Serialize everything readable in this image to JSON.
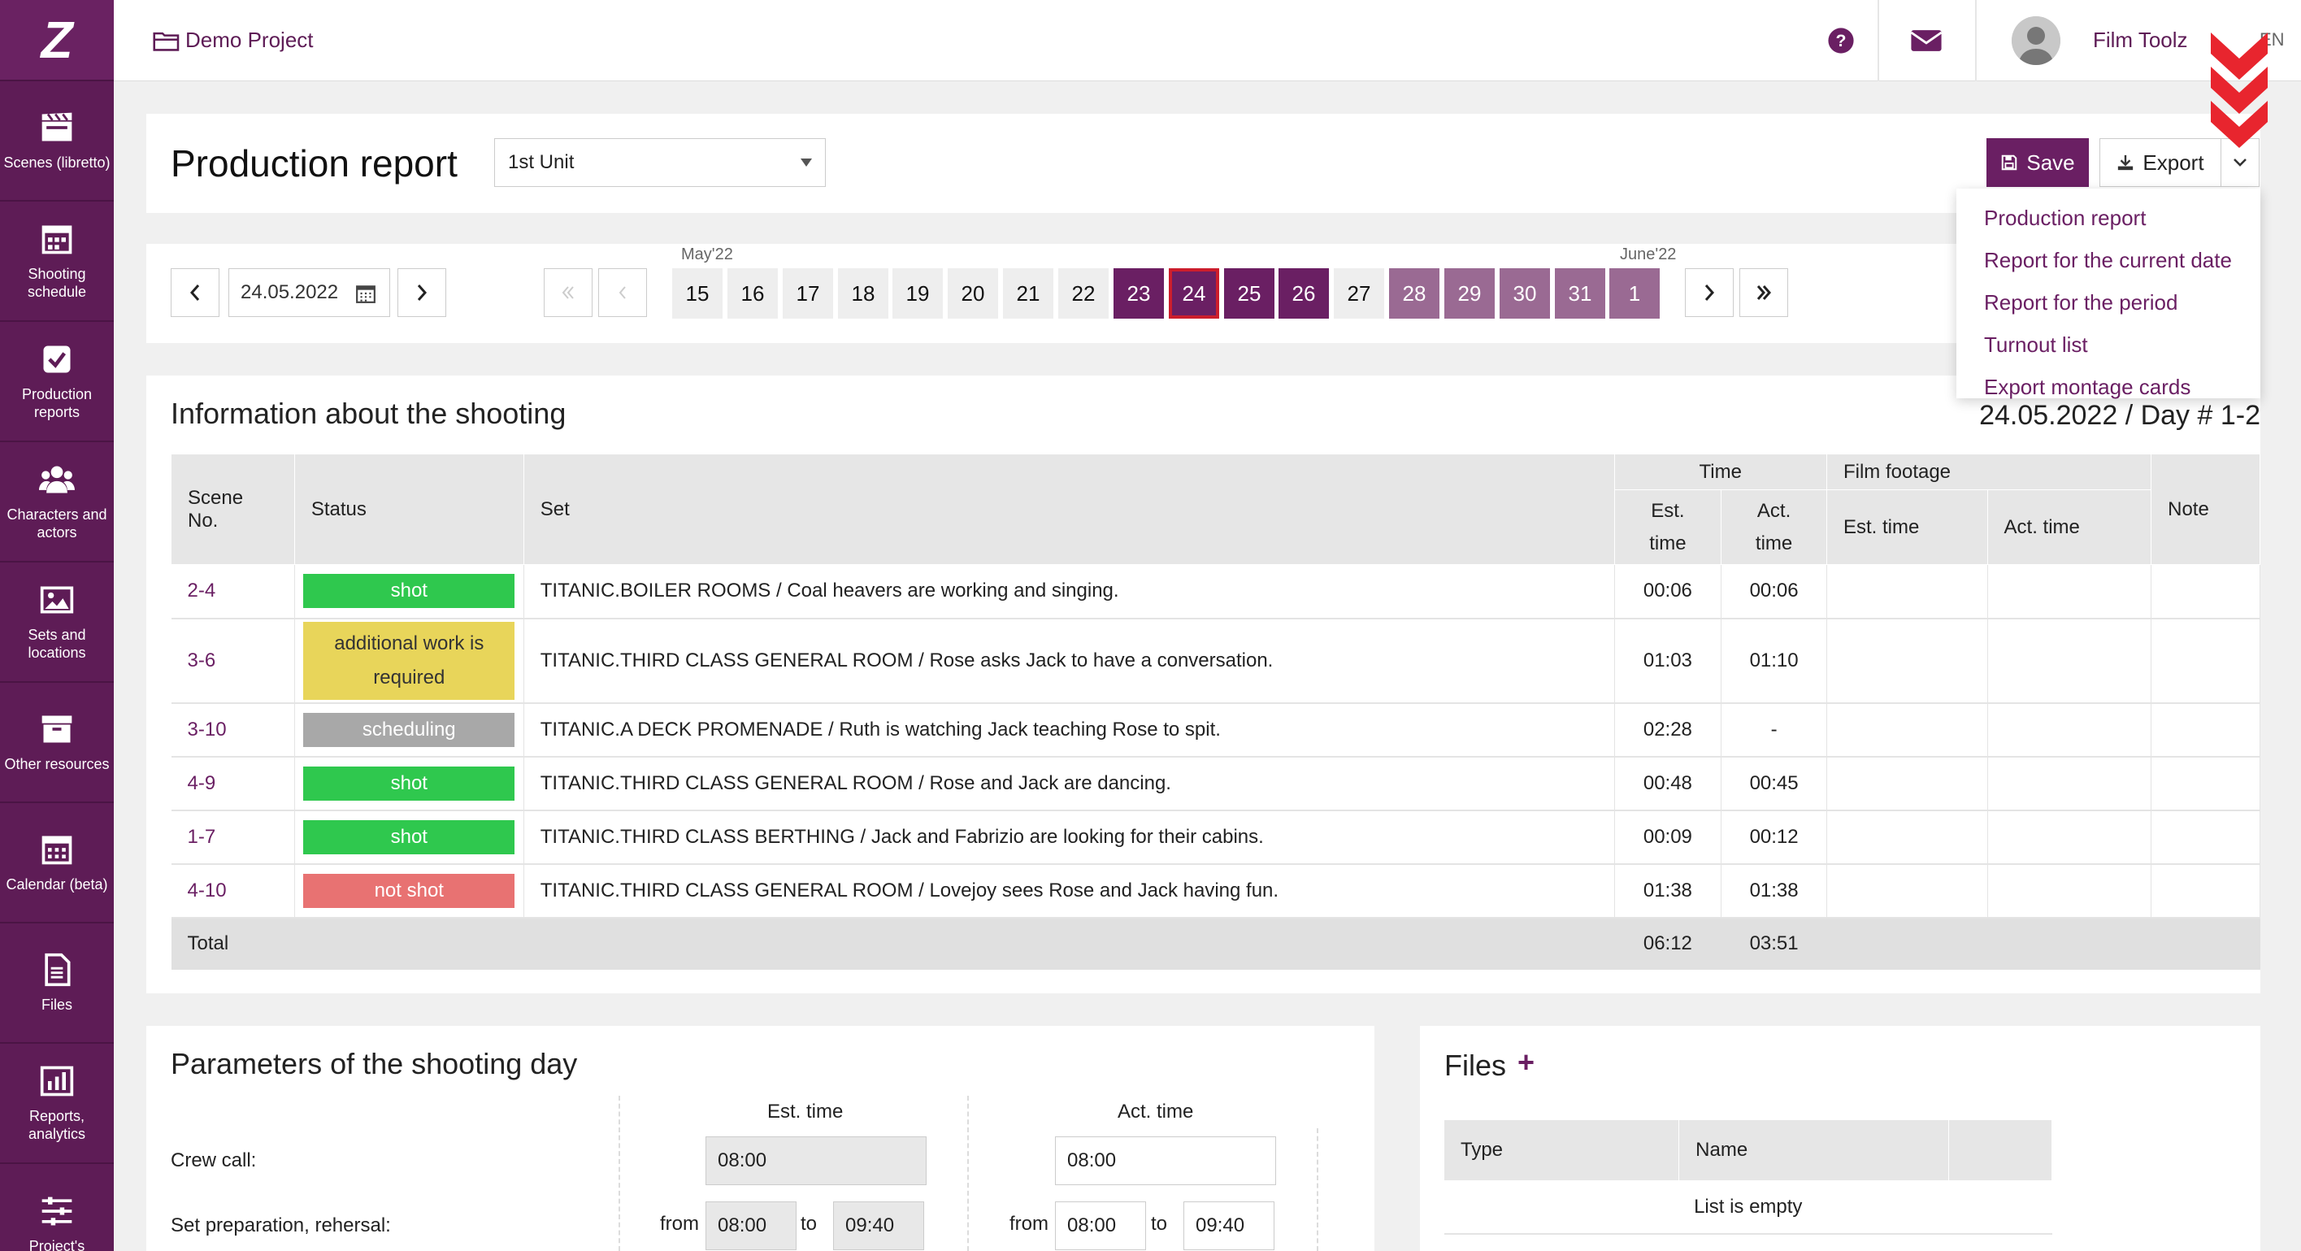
{
  "sidebar": {
    "logo": "Z",
    "items": [
      {
        "label": "Scenes (libretto)",
        "icon": "clapperboard-icon"
      },
      {
        "label": "Shooting schedule",
        "icon": "calendar-grid-icon"
      },
      {
        "label": "Production reports",
        "icon": "checkbox-icon"
      },
      {
        "label": "Characters and actors",
        "icon": "people-icon"
      },
      {
        "label": "Sets and locations",
        "icon": "image-icon"
      },
      {
        "label": "Other resources",
        "icon": "archive-box-icon"
      },
      {
        "label": "Calendar (beta)",
        "icon": "calendar-icon"
      },
      {
        "label": "Files",
        "icon": "file-icon"
      },
      {
        "label": "Reports, analytics",
        "icon": "bar-chart-icon"
      },
      {
        "label": "Project's",
        "icon": "sliders-icon"
      }
    ]
  },
  "topbar": {
    "project": "Demo Project",
    "user_name": "Film Toolz",
    "lang": "EN"
  },
  "header": {
    "title": "Production report",
    "unit_select": "1st Unit",
    "save_label": "Save",
    "export_label": "Export"
  },
  "export_menu": [
    "Production report",
    "Report for the current date",
    "Report for the period",
    "Turnout list",
    "Export montage cards"
  ],
  "date_nav": {
    "date": "24.05.2022",
    "month1": "May'22",
    "month2": "June'22",
    "days": [
      {
        "d": "15",
        "s": "empty"
      },
      {
        "d": "16",
        "s": "empty"
      },
      {
        "d": "17",
        "s": "empty"
      },
      {
        "d": "18",
        "s": "empty"
      },
      {
        "d": "19",
        "s": "empty"
      },
      {
        "d": "20",
        "s": "empty"
      },
      {
        "d": "21",
        "s": "empty"
      },
      {
        "d": "22",
        "s": "empty"
      },
      {
        "d": "23",
        "s": "dark"
      },
      {
        "d": "24",
        "s": "selected"
      },
      {
        "d": "25",
        "s": "dark"
      },
      {
        "d": "26",
        "s": "dark"
      },
      {
        "d": "27",
        "s": "empty"
      },
      {
        "d": "28",
        "s": "light"
      },
      {
        "d": "29",
        "s": "light"
      },
      {
        "d": "30",
        "s": "light"
      },
      {
        "d": "31",
        "s": "light"
      },
      {
        "d": "1",
        "s": "light"
      }
    ]
  },
  "info": {
    "title": "Information about the shooting",
    "day_label": "24.05.2022 / Day # 1-2",
    "headers": {
      "scene": "Scene No.",
      "status": "Status",
      "set": "Set",
      "time": "Time",
      "film": "Film footage",
      "est": "Est.",
      "act": "Act.",
      "time_word": "time",
      "est_time": "Est. time",
      "act_time": "Act. time",
      "note": "Note"
    },
    "rows": [
      {
        "scene": "2-4",
        "status": "shot",
        "status_color": "#2fc84e",
        "set": "TITANIC.BOILER ROOMS / Coal heavers are working and singing.",
        "est": "00:06",
        "act": "00:06"
      },
      {
        "scene": "3-6",
        "status": "additional work is required",
        "status_color": "#e8d55a",
        "set": "TITANIC.THIRD CLASS GENERAL ROOM / Rose asks Jack to have a conversation.",
        "est": "01:03",
        "act": "01:10"
      },
      {
        "scene": "3-10",
        "status": "scheduling",
        "status_color": "#a8a8a8",
        "set": "TITANIC.A DECK PROMENADE / Ruth is watching Jack teaching Rose to spit.",
        "est": "02:28",
        "act": "-"
      },
      {
        "scene": "4-9",
        "status": "shot",
        "status_color": "#2fc84e",
        "set": "TITANIC.THIRD CLASS GENERAL ROOM / Rose and Jack are dancing.",
        "est": "00:48",
        "act": "00:45"
      },
      {
        "scene": "1-7",
        "status": "shot",
        "status_color": "#2fc84e",
        "set": "TITANIC.THIRD CLASS BERTHING / Jack and Fabrizio are looking for their cabins.",
        "est": "00:09",
        "act": "00:12"
      },
      {
        "scene": "4-10",
        "status": "not shot",
        "status_color": "#e87272",
        "set": "TITANIC.THIRD CLASS GENERAL ROOM / Lovejoy sees Rose and Jack having fun.",
        "est": "01:38",
        "act": "01:38"
      }
    ],
    "total_label": "Total",
    "total_est": "06:12",
    "total_act": "03:51"
  },
  "params": {
    "title": "Parameters of the shooting day",
    "est_header": "Est. time",
    "act_header": "Act. time",
    "crew_call_label": "Crew call:",
    "crew_call_est": "08:00",
    "crew_call_act": "08:00",
    "prep_label": "Set preparation, rehersal:",
    "from": "from",
    "to": "to",
    "prep_est_from": "08:00",
    "prep_est_to": "09:40",
    "prep_act_from": "08:00",
    "prep_act_to": "09:40"
  },
  "files": {
    "title": "Files",
    "add": "+",
    "col_type": "Type",
    "col_name": "Name",
    "empty": "List is empty"
  }
}
